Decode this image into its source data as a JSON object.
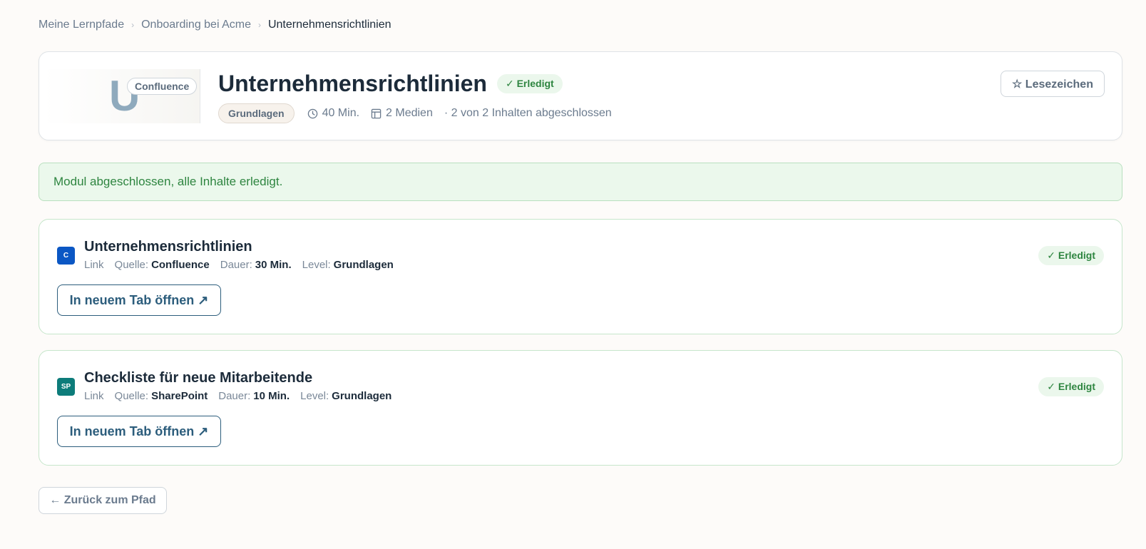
{
  "breadcrumb": {
    "items": [
      "Meine Lernpfade",
      "Onboarding bei Acme"
    ],
    "current": "Unternehmensrichtlinien",
    "separator": "›"
  },
  "module": {
    "thumb_letter": "U",
    "thumb_source": "Confluence",
    "title": "Unternehmensrichtlinien",
    "status": "✓ Erledigt",
    "level": "Grundlagen",
    "duration": "40 Min.",
    "media": "2 Medien",
    "progress": "· 2 von 2 Inhalten abgeschlossen",
    "bookmark_label": "☆ Lesezeichen"
  },
  "banner": {
    "message": "Modul abgeschlossen, alle Inhalte erledigt."
  },
  "labels": {
    "type": "Link",
    "source": "Quelle:",
    "duration": "Dauer:",
    "level": "Level:",
    "open_button": "In neuem Tab öffnen ↗"
  },
  "items": [
    {
      "icon_text": "C",
      "icon_color": "#0b57c4",
      "title": "Unternehmensrichtlinien",
      "source": "Confluence",
      "duration": "30 Min.",
      "level": "Grundlagen",
      "status": "✓ Erledigt"
    },
    {
      "icon_text": "SP",
      "icon_color": "#0d7c7a",
      "title": "Checkliste für neue Mitarbeitende",
      "source": "SharePoint",
      "duration": "10 Min.",
      "level": "Grundlagen",
      "status": "✓ Erledigt"
    }
  ],
  "back_label": "← Zurück zum Pfad",
  "colors": {
    "success": "#2e8540",
    "accent": "#2c5d7c",
    "confluence": "#0b57c4",
    "sharepoint": "#0d7c7a"
  }
}
